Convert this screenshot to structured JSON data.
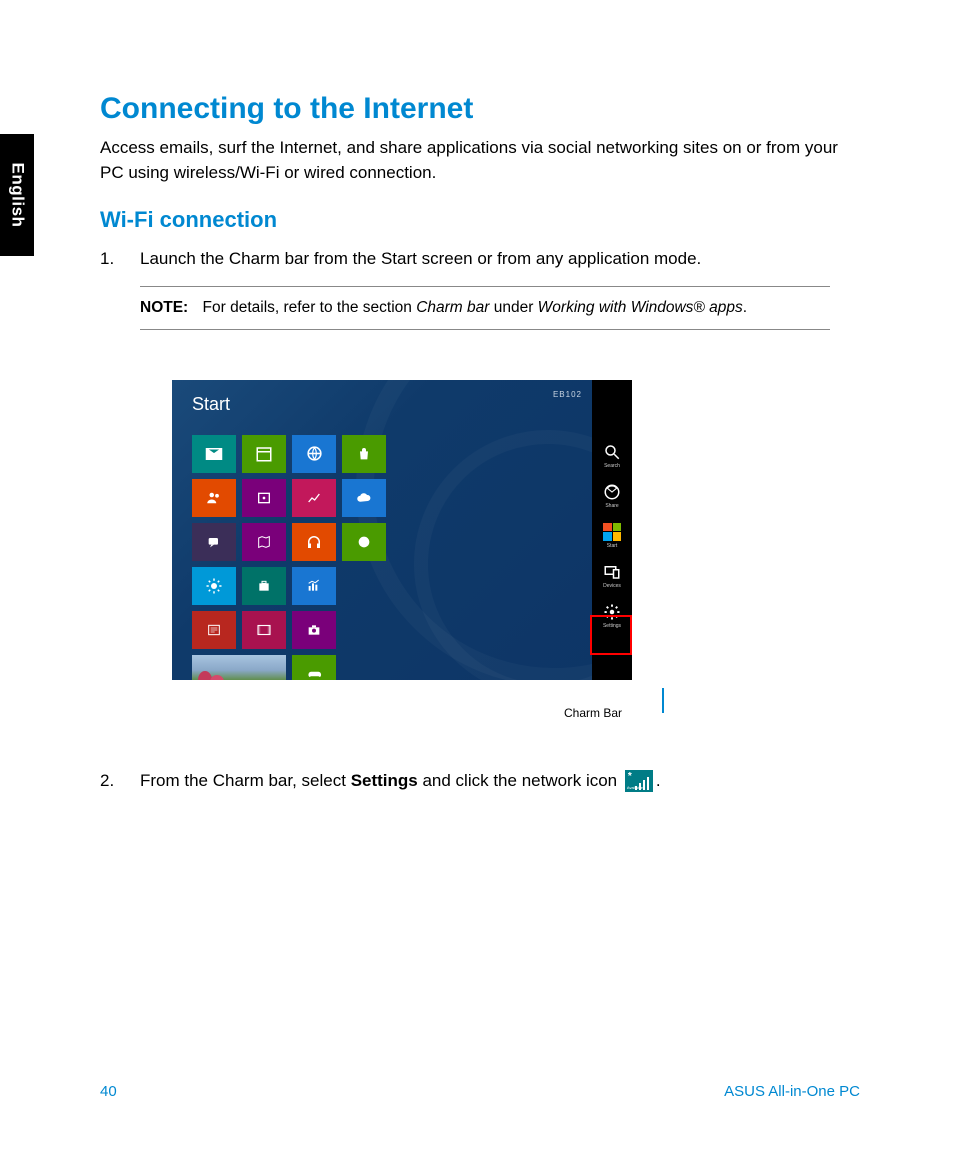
{
  "language_tab": "English",
  "title": "Connecting to the Internet",
  "intro": "Access emails, surf the Internet, and share applications via social networking sites on or from your PC using wireless/Wi-Fi or wired connection.",
  "subtitle": "Wi-Fi connection",
  "step1_num": "1.",
  "step1_text": "Launch the Charm bar from the Start screen or from any application mode.",
  "note_label": "NOTE:",
  "note_text_1": "For details, refer to the section ",
  "note_italic_1": "Charm bar",
  "note_text_2": " under ",
  "note_italic_2": "Working with Windows® apps",
  "note_text_3": ".",
  "start_label": "Start",
  "top_small": "EB102",
  "charm_items": {
    "search": "Search",
    "share": "Share",
    "start": "Start",
    "devices": "Devices",
    "settings": "Settings"
  },
  "charm_caption": "Charm Bar",
  "step2_num": "2.",
  "step2_a": "From the Charm bar, select ",
  "step2_bold": "Settings",
  "step2_b": " and click the network icon ",
  "step2_c": ".",
  "net_available": "Available",
  "footer_page": "40",
  "footer_brand": "ASUS All-in-One PC"
}
